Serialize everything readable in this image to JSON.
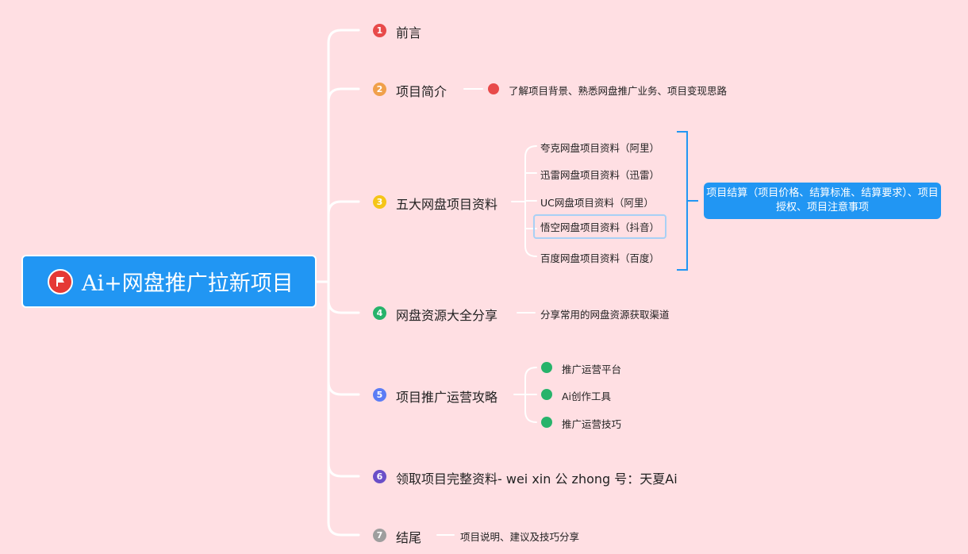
{
  "root": {
    "title": "Ai+网盘推广拉新项目",
    "icon": "flag-icon"
  },
  "branches": [
    {
      "num": "1",
      "label": "前言",
      "color": "#e84a4a"
    },
    {
      "num": "2",
      "label": "项目简介",
      "color": "#f0a04b",
      "children": [
        "了解项目背景、熟悉网盘推广业务、项目变现思路"
      ]
    },
    {
      "num": "3",
      "label": "五大网盘项目资料",
      "color": "#f5c518",
      "children": [
        "夸克网盘项目资料（阿里）",
        "迅雷网盘项目资料（迅雷）",
        "UC网盘项目资料（阿里）",
        "悟空网盘项目资料（抖音）",
        "百度网盘项目资料（百度）"
      ],
      "summary": "项目结算（项目价格、结算标准、结算要求）、项目授权、项目注意事项"
    },
    {
      "num": "4",
      "label": "网盘资源大全分享",
      "color": "#27b36b",
      "children": [
        "分享常用的网盘资源获取渠道"
      ]
    },
    {
      "num": "5",
      "label": "项目推广运营攻略",
      "color": "#5b7cf5",
      "children": [
        "推广运营平台",
        "Ai创作工具",
        "推广运营技巧"
      ]
    },
    {
      "num": "6",
      "label": "领取项目完整资料- wei xin 公 zhong 号：天夏Ai",
      "color": "#6a4fc8"
    },
    {
      "num": "7",
      "label": "结尾",
      "color": "#9e9e9e",
      "children": [
        "项目说明、建议及技巧分享"
      ]
    }
  ]
}
